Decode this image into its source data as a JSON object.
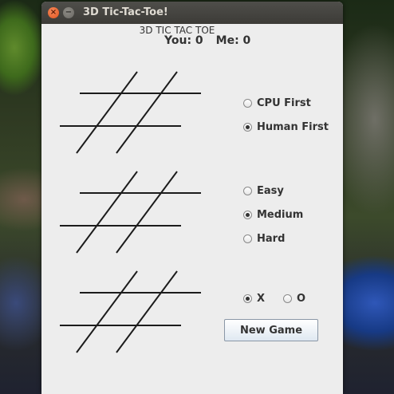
{
  "window": {
    "title": "3D Tic-Tac-Toe!",
    "close_glyph": "×",
    "minimize_glyph": "−"
  },
  "header": {
    "heading": "3D TIC TAC TOE",
    "you_score": "You: 0",
    "me_score": "Me: 0"
  },
  "player_order": {
    "options": [
      {
        "label": "CPU First",
        "selected": false
      },
      {
        "label": "Human First",
        "selected": true
      }
    ]
  },
  "difficulty": {
    "options": [
      {
        "label": "Easy",
        "selected": false
      },
      {
        "label": "Medium",
        "selected": true
      },
      {
        "label": "Hard",
        "selected": false
      }
    ]
  },
  "symbol": {
    "options": [
      {
        "label": "X",
        "selected": true
      },
      {
        "label": "O",
        "selected": false
      }
    ]
  },
  "actions": {
    "new_game_label": "New Game"
  },
  "colors": {
    "titlebar": "#3c3b37",
    "window_bg": "#ededed",
    "close_button": "#e2531c"
  }
}
